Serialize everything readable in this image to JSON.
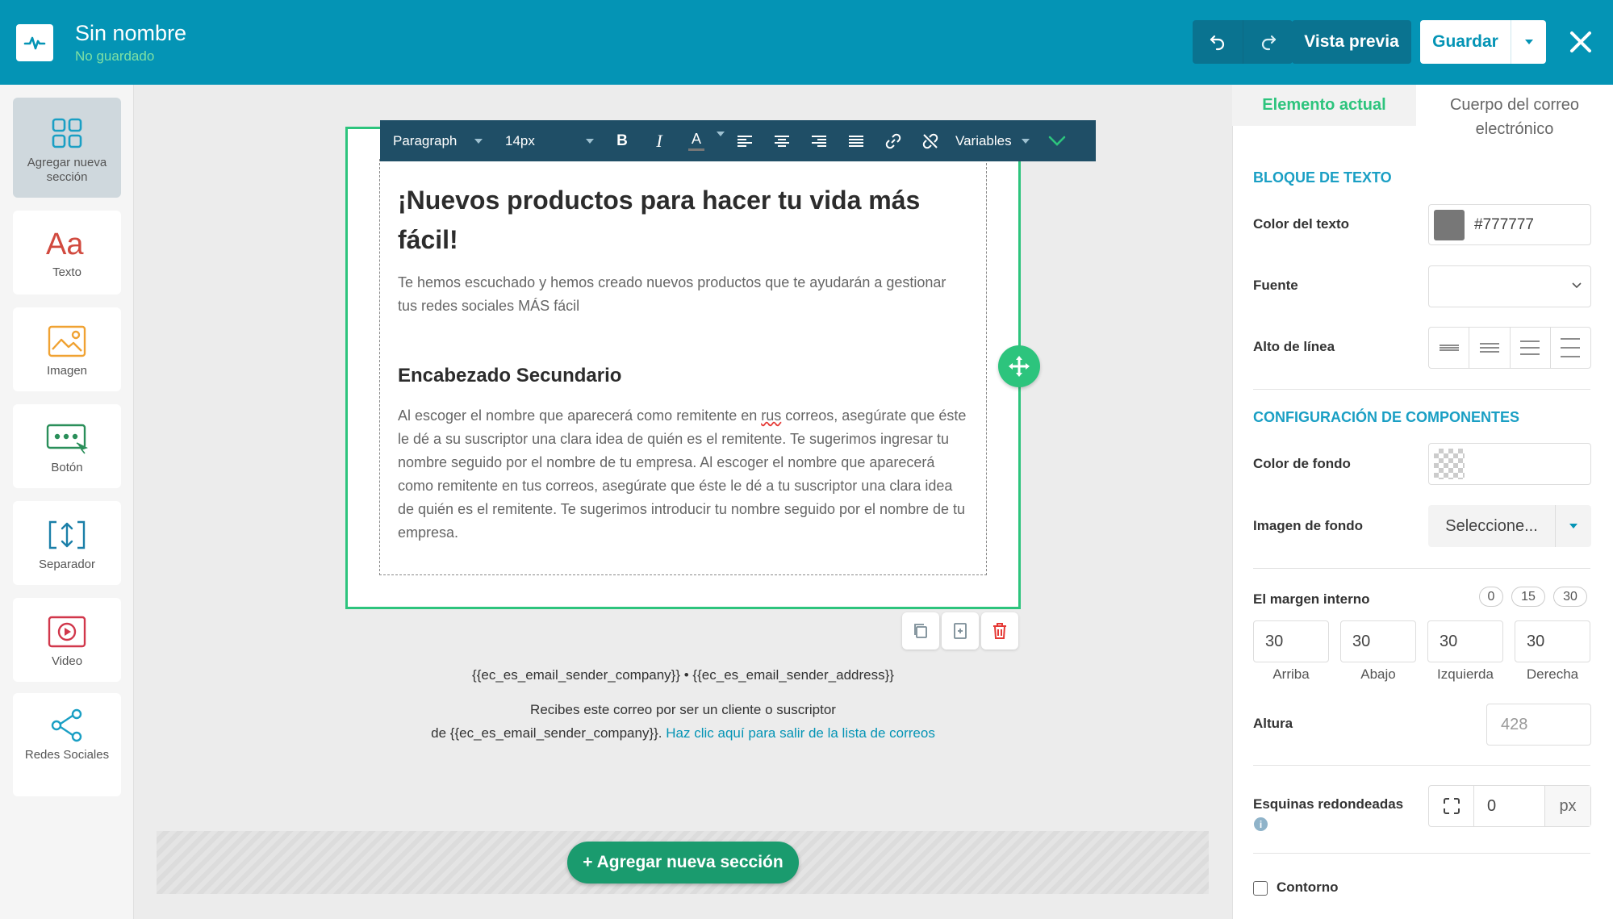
{
  "header": {
    "title": "Sin nombre",
    "status": "No guardado",
    "preview_label": "Vista previa",
    "save_label": "Guardar",
    "colors": {
      "bar": "#0494b5",
      "status": "#7ee0a4"
    }
  },
  "left_tools": [
    {
      "label": "Agregar nueva sección",
      "icon": "grid-icon"
    },
    {
      "label": "Texto",
      "icon": "text-aa-icon"
    },
    {
      "label": "Imagen",
      "icon": "image-icon"
    },
    {
      "label": "Botón",
      "icon": "button-icon"
    },
    {
      "label": "Separador",
      "icon": "separator-icon"
    },
    {
      "label": "Video",
      "icon": "video-icon"
    },
    {
      "label": "Redes Sociales",
      "icon": "share-icon"
    }
  ],
  "toolbar": {
    "format": "Paragraph",
    "size": "14px",
    "bold": "B",
    "italic": "I",
    "font_color": "A",
    "variables": "Variables"
  },
  "email": {
    "heading": "¡Nuevos productos para hacer tu vida más fácil!",
    "intro": "Te hemos escuchado y hemos creado nuevos productos que te ayudarán a gestionar tus redes sociales MÁS fácil",
    "subheading": "Encabezado Secundario",
    "body_before": "Al escoger el nombre que aparecerá como remitente en ",
    "body_misspelled": "rus",
    "body_after": " correos, asegúrate que éste le dé a su suscriptor una clara idea de quién es el remitente. Te sugerimos ingresar tu nombre seguido por el nombre de tu empresa. Al escoger el nombre que aparecerá como remitente en tus correos, asegúrate que éste le dé a tu suscriptor una clara idea de quién es el remitente. Te sugerimos introducir tu nombre seguido por el nombre de tu empresa."
  },
  "footer": {
    "sender_line": "{{ec_es_email_sender_company}} • {{ec_es_email_sender_address}}",
    "reason_line1": "Recibes este correo por ser un cliente o suscriptor",
    "reason_line2": "de {{ec_es_email_sender_company}}.",
    "unsubscribe": "Haz clic aquí para salir de la lista de correos"
  },
  "add_section_label": "+ Agregar nueva sección",
  "right_panel": {
    "tab_current": "Elemento actual",
    "tab_body": "Cuerpo del correo electrónico",
    "text_block_title": "BLOQUE DE TEXTO",
    "text_color_label": "Color del texto",
    "text_color_value": "#777777",
    "font_label": "Fuente",
    "line_height_label": "Alto de línea",
    "components_title": "CONFIGURACIÓN DE COMPONENTES",
    "bg_color_label": "Color de fondo",
    "bg_image_label": "Imagen de fondo",
    "bg_image_select": "Seleccione...",
    "padding_label": "El margen interno",
    "padding_presets": [
      "0",
      "15",
      "30"
    ],
    "padding": [
      {
        "value": "30",
        "caption": "Arriba"
      },
      {
        "value": "30",
        "caption": "Abajo"
      },
      {
        "value": "30",
        "caption": "Izquierda"
      },
      {
        "value": "30",
        "caption": "Derecha"
      }
    ],
    "height_label": "Altura",
    "height_value": "428",
    "radius_label": "Esquinas redondeadas",
    "radius_value": "0",
    "radius_unit": "px",
    "outline_label": "Contorno",
    "accent_color": "#2dc47d",
    "title_color": "#1a9fc4"
  }
}
